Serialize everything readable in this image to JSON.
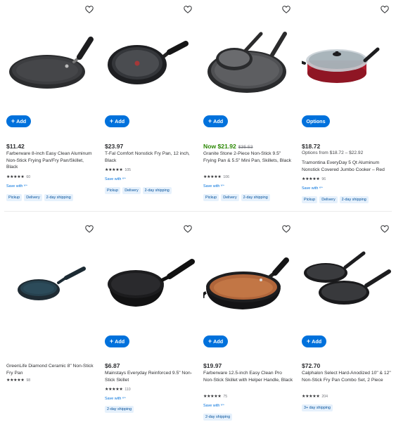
{
  "add_label": "Add",
  "options_label": "Options",
  "save_with_label": "Save with",
  "products": [
    {
      "price": "$11.42",
      "title": "Farberware 8-inch Easy Clean Aluminum Non-Stick Frying Pan/Fry Pan/Skillet, Black",
      "stars": "★★★★★",
      "rating_count": "60",
      "save_with": true,
      "tags": [
        "Pickup",
        "Delivery",
        "2-day shipping"
      ],
      "button": "Add",
      "icon": "frying-pan-image"
    },
    {
      "price": "$23.97",
      "title": "T-Fal Comfort Nonstick Fry Pan, 12 inch, Black",
      "stars": "★★★★★",
      "rating_count": "105",
      "save_with": true,
      "tags": [
        "Pickup",
        "Delivery",
        "2-day shipping"
      ],
      "button": "Add",
      "icon": "frying-pan-image"
    },
    {
      "price_now": "Now $21.92",
      "price_was": "$35.53",
      "title": "Granite Stone 2-Piece Non-Stick 9.5\" Frying Pan & 5.5\" Mini Pan, Skillets, Black",
      "stars": "★★★★★",
      "rating_count": "106",
      "save_with": true,
      "tags": [
        "Pickup",
        "Delivery",
        "2-day shipping"
      ],
      "button": "Add",
      "icon": "two-pans-image"
    },
    {
      "price": "$18.72",
      "options_from": "Options from $18.72 – $22.92",
      "title": "Tramontina EveryDay 5 Qt Aluminum Nonstick Covered Jumbo Cooker – Red",
      "stars": "★★★★★",
      "rating_count": "96",
      "save_with": true,
      "tags": [
        "Pickup",
        "Delivery",
        "2-day shipping"
      ],
      "button": "Options",
      "icon": "covered-cooker-image"
    },
    {
      "title": "GreenLife Diamond Ceramic 8\" Non-Stick Fry Pan",
      "stars": "★★★★★",
      "rating_count": "98",
      "save_with": false,
      "tags": [],
      "button": null,
      "icon": "frying-pan-image"
    },
    {
      "price": "$6.87",
      "title": "Mainstays Everyday Reinforced 9.5\" Non-Stick Skillet",
      "stars": "★★★★★",
      "rating_count": "110",
      "save_with": true,
      "tags": [
        "2-day shipping"
      ],
      "button": "Add",
      "icon": "frying-pan-image"
    },
    {
      "price": "$19.97",
      "title": "Farberware 12.5-inch Easy Clean Pro Non-Stick Skillet with Helper Handle, Black",
      "stars": "★★★★★",
      "rating_count": "75",
      "save_with": true,
      "tags": [
        "2-day shipping"
      ],
      "button": "Add",
      "icon": "copper-skillet-image"
    },
    {
      "price": "$72.70",
      "title": "Calphalon Select Hard-Anodized 10\" & 12\" Non-Stick Fry Pan Combo Set, 2 Piece",
      "stars": "★★★★★",
      "rating_count": "204",
      "save_with": false,
      "tags": [
        "3+ day shipping"
      ],
      "button": "Add",
      "icon": "two-pans-image"
    }
  ],
  "colors": {
    "accent": "#0071dc",
    "now_price": "#2a8703",
    "tag_bg": "#e6f1fc",
    "tag_text": "#004f9a",
    "cooker_red": "#b01c2e"
  }
}
